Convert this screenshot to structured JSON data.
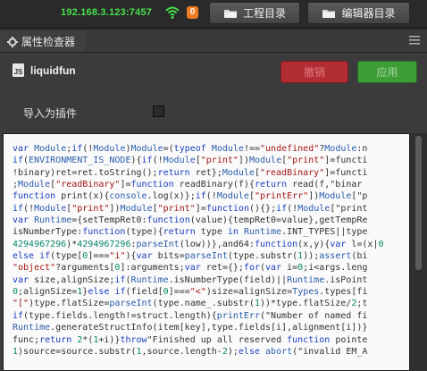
{
  "topbar": {
    "ip": "192.168.3.123:7457",
    "badge": "0",
    "project_label": "工程目录",
    "editor_label": "编辑器目录"
  },
  "panel": {
    "tab_label": "属性检查器"
  },
  "inspector": {
    "asset_name": "liquidfun",
    "cancel_label": "撤销",
    "apply_label": "应用",
    "plugin_label": "导入为插件",
    "plugin_checked": false
  },
  "code_lines": [
    "var Module;if(!Module)Module=(typeof Module!==\"undefined\"?Module:n",
    "if(ENVIRONMENT_IS_NODE){if(!Module[\"print\"])Module[\"print\"]=functi",
    "!binary)ret=ret.toString();return ret};Module[\"readBinary\"]=functi",
    ";Module[\"readBinary\"]=function readBinary(f){return read(f,\"binar",
    "function print(x){console.log(x)};if(!Module[\"printErr\"])Module[\"p",
    "if(!Module[\"print\"])Module[\"print\"]=function(){};if(!Module[\"print",
    "var Runtime={setTempRet0:function(value){tempRet0=value},getTempRe",
    "isNumberType:function(type){return type in Runtime.INT_TYPES||type",
    "4294967296)*4294967296:parseInt(low))},and64:function(x,y){var l=(x|0",
    "else if(type[0]===\"i\"){var bits=parseInt(type.substr(1));assert(bi",
    "\"object\"?arguments[0]:arguments;var ret={};for(var i=0;i<args.leng",
    "var size,alignSize;if(Runtime.isNumberType(field)||Runtime.isPoint",
    "0;alignSize=1}else if(field[0]===\"<\")size=alignSize=Types.types[fi",
    "\"[\")type.flatSize=parseInt(type.name_.substr(1))*type.flatSize/2;t",
    "if(type.fields.length!=struct.length){printErr(\"Number of named fi",
    "Runtime.generateStructInfo(item[key],type.fields[i],alignment[i])}",
    "func;return 2*(1+i)}throw\"Finished up all reserved function pointe",
    "1)source=source.substr(1,source.length-2);else abort(\"invalid EM_A",
    "                                                                   "
  ],
  "colors": {
    "ip": "#46e04a",
    "badge": "#ee7b22",
    "cancel": "#b22e33",
    "apply": "#3f9d36"
  }
}
